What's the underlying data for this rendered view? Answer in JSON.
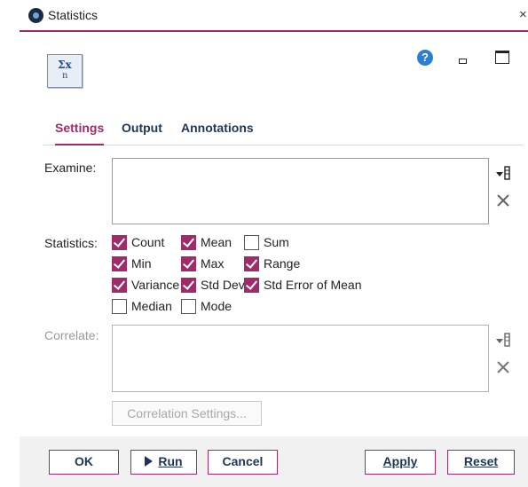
{
  "window": {
    "title": "Statistics",
    "close_glyph": "×"
  },
  "node_icon": {
    "symbol_top": "Σx",
    "symbol_bottom": "n"
  },
  "header_icons": {
    "help": "?"
  },
  "tabs": [
    {
      "label": "Settings",
      "active": true
    },
    {
      "label": "Output",
      "active": false
    },
    {
      "label": "Annotations",
      "active": false
    }
  ],
  "examine": {
    "label": "Examine:"
  },
  "statistics": {
    "label": "Statistics:",
    "options": [
      {
        "label": "Count",
        "checked": true
      },
      {
        "label": "Mean",
        "checked": true
      },
      {
        "label": "Sum",
        "checked": false
      },
      {
        "label": "Min",
        "checked": true
      },
      {
        "label": "Max",
        "checked": true
      },
      {
        "label": "Range",
        "checked": true
      },
      {
        "label": "Variance",
        "checked": true
      },
      {
        "label": "Std Dev",
        "checked": true
      },
      {
        "label": "Std Error of Mean",
        "checked": true
      },
      {
        "label": "Median",
        "checked": false
      },
      {
        "label": "Mode",
        "checked": false
      }
    ]
  },
  "correlate": {
    "label": "Correlate:",
    "settings_button": "Correlation Settings..."
  },
  "footer": {
    "ok": "OK",
    "run": "Run",
    "cancel": "Cancel",
    "apply": "Apply",
    "reset": "Reset"
  },
  "colors": {
    "accent": "#a02b6a",
    "navy": "#1f3556",
    "help_blue": "#2c7fd1"
  }
}
